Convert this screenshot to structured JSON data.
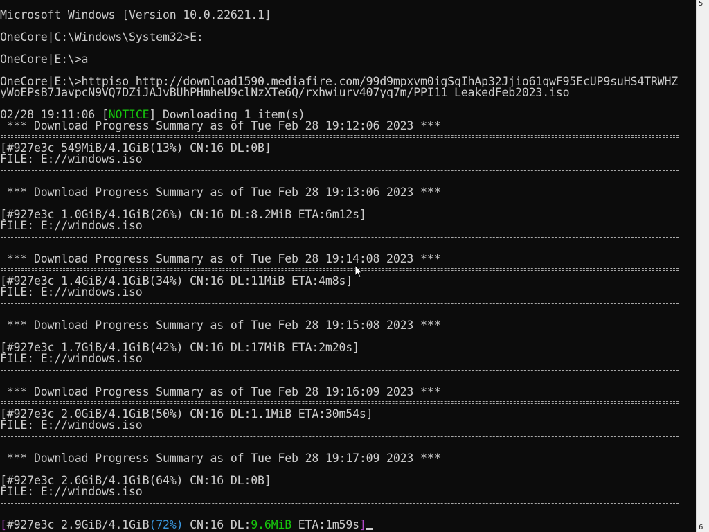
{
  "console": {
    "lines": [
      {
        "kind": "text",
        "text": "Microsoft Windows [Version 10.0.22621.1]"
      },
      {
        "kind": "blank"
      },
      {
        "kind": "text",
        "text": "OneCore|C:\\Windows\\System32>E:"
      },
      {
        "kind": "blank"
      },
      {
        "kind": "text",
        "text": "OneCore|E:\\>a"
      },
      {
        "kind": "blank"
      },
      {
        "kind": "text",
        "text": "OneCore|E:\\>httpiso http://download1590.mediafire.com/99d9mpxvm0igSqIhAp32Jjio61qwF95EcUP9suHS4TRWHZ"
      },
      {
        "kind": "text",
        "text": "yWoEPsB7JavpcN9VQ7DZiJAJvBUhPHmheU9clNzXTe6Q/rxhwiurv407yq7m/PPI11_LeakedFeb2023.iso"
      },
      {
        "kind": "blank"
      },
      {
        "kind": "notice",
        "pre": "02/28 19:11:06 [",
        "tag": "NOTICE",
        "post": "] Downloading 1 item(s)"
      },
      {
        "kind": "text",
        "text": " *** Download Progress Summary as of Tue Feb 28 19:12:06 2023 ***"
      },
      {
        "kind": "rule2"
      },
      {
        "kind": "text",
        "text": "[#927e3c 549MiB/4.1GiB(13%) CN:16 DL:0B]"
      },
      {
        "kind": "text",
        "text": "FILE: E://windows.iso"
      },
      {
        "kind": "rule1"
      },
      {
        "kind": "blank"
      },
      {
        "kind": "text",
        "text": " *** Download Progress Summary as of Tue Feb 28 19:13:06 2023 ***"
      },
      {
        "kind": "rule2"
      },
      {
        "kind": "text",
        "text": "[#927e3c 1.0GiB/4.1GiB(26%) CN:16 DL:8.2MiB ETA:6m12s]"
      },
      {
        "kind": "text",
        "text": "FILE: E://windows.iso"
      },
      {
        "kind": "rule1"
      },
      {
        "kind": "blank"
      },
      {
        "kind": "text",
        "text": " *** Download Progress Summary as of Tue Feb 28 19:14:08 2023 ***"
      },
      {
        "kind": "rule2"
      },
      {
        "kind": "text",
        "text": "[#927e3c 1.4GiB/4.1GiB(34%) CN:16 DL:11MiB ETA:4m8s]"
      },
      {
        "kind": "text",
        "text": "FILE: E://windows.iso"
      },
      {
        "kind": "rule1"
      },
      {
        "kind": "blank"
      },
      {
        "kind": "text",
        "text": " *** Download Progress Summary as of Tue Feb 28 19:15:08 2023 ***"
      },
      {
        "kind": "rule2"
      },
      {
        "kind": "text",
        "text": "[#927e3c 1.7GiB/4.1GiB(42%) CN:16 DL:17MiB ETA:2m20s]"
      },
      {
        "kind": "text",
        "text": "FILE: E://windows.iso"
      },
      {
        "kind": "rule1"
      },
      {
        "kind": "blank"
      },
      {
        "kind": "text",
        "text": " *** Download Progress Summary as of Tue Feb 28 19:16:09 2023 ***"
      },
      {
        "kind": "rule2"
      },
      {
        "kind": "text",
        "text": "[#927e3c 2.0GiB/4.1GiB(50%) CN:16 DL:1.1MiB ETA:30m54s]"
      },
      {
        "kind": "text",
        "text": "FILE: E://windows.iso"
      },
      {
        "kind": "rule1"
      },
      {
        "kind": "blank"
      },
      {
        "kind": "text",
        "text": " *** Download Progress Summary as of Tue Feb 28 19:17:09 2023 ***"
      },
      {
        "kind": "rule2"
      },
      {
        "kind": "text",
        "text": "[#927e3c 2.6GiB/4.1GiB(64%) CN:16 DL:0B]"
      },
      {
        "kind": "text",
        "text": "FILE: E://windows.iso"
      },
      {
        "kind": "rule1"
      },
      {
        "kind": "blank"
      },
      {
        "kind": "live",
        "segments": [
          {
            "text": "[",
            "color": "magenta"
          },
          {
            "text": "#927e3c 2.9GiB/4.1GiB",
            "color": "default"
          },
          {
            "text": "(72%)",
            "color": "cyan"
          },
          {
            "text": " CN:16 DL:",
            "color": "default"
          },
          {
            "text": "9.6MiB",
            "color": "green"
          },
          {
            "text": " ETA:1m59s",
            "color": "default"
          },
          {
            "text": "]",
            "color": "magenta"
          }
        ]
      }
    ]
  },
  "scrollbar": {
    "top_label": "5",
    "bottom_label": "6"
  },
  "colors": {
    "background": "#0c0c0c",
    "foreground": "#cccccc",
    "notice": "#16c60c",
    "magenta": "#b148c6",
    "cyan": "#3a96dd",
    "green": "#16c60c"
  },
  "icons": {
    "pointer": "mouse-pointer-icon"
  }
}
